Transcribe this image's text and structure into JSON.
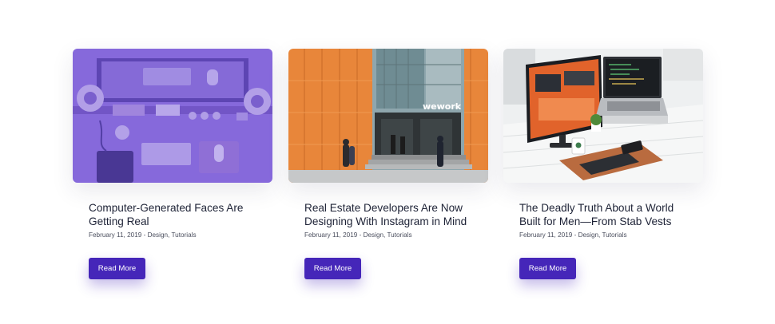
{
  "posts": [
    {
      "title_line1": "Computer-Generated Faces Are",
      "title_line2": "Getting Real",
      "meta": "February 11, 2019 - Design, Tutorials",
      "button_label": "Read More"
    },
    {
      "title_line1": "Real Estate Developers Are Now",
      "title_line2": "Designing With Instagram in Mind",
      "meta": "February 11, 2019 - Design, Tutorials",
      "button_label": "Read More",
      "sign_text": "wework"
    },
    {
      "title_line1": "The Deadly Truth About a World",
      "title_line2": "Built for Men—From Stab Vests",
      "meta": "February 11, 2019 - Design, Tutorials",
      "button_label": "Read More"
    }
  ],
  "colors": {
    "accent": "#4526b9",
    "title": "#1d2236",
    "meta": "#4b4f5e",
    "image_overlay": "#7b5bd6"
  }
}
